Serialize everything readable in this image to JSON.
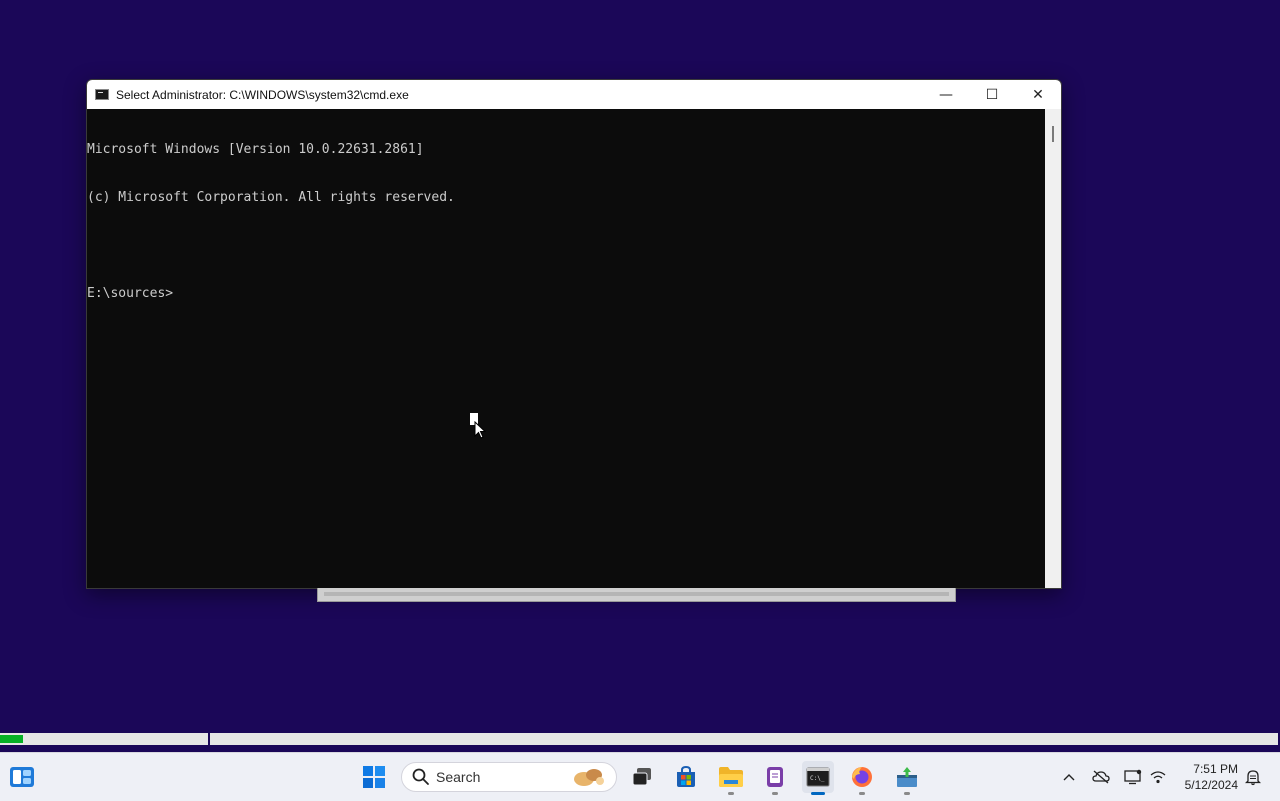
{
  "window": {
    "title": "Select Administrator: C:\\WINDOWS\\system32\\cmd.exe",
    "minimize": "—",
    "maximize": "☐",
    "close": "✕",
    "console_lines": [
      "Microsoft Windows [Version 10.0.22631.2861]",
      "(c) Microsoft Corporation. All rights reserved.",
      "",
      "E:\\sources>"
    ]
  },
  "progress": {
    "fraction": 0.018
  },
  "taskbar": {
    "search_placeholder": "Search",
    "apps": [
      "widgets-icon",
      "start-icon",
      "search-icon",
      "task-view-icon",
      "store-icon",
      "file-explorer-icon",
      "notepad-icon",
      "terminal-icon",
      "firefox-icon",
      "installer-icon"
    ],
    "tray_icons": [
      "chevron-up-icon",
      "onedrive-off-icon",
      "display-icon",
      "network-icon",
      "notification-icon"
    ]
  },
  "clock": {
    "time": "7:51 PM",
    "date": "5/12/2024"
  },
  "colors": {
    "desktop": "#1b0758",
    "console_bg": "#0c0c0c",
    "console_text": "#cccccc",
    "progress": "#06b025",
    "accent": "#0067c0"
  }
}
